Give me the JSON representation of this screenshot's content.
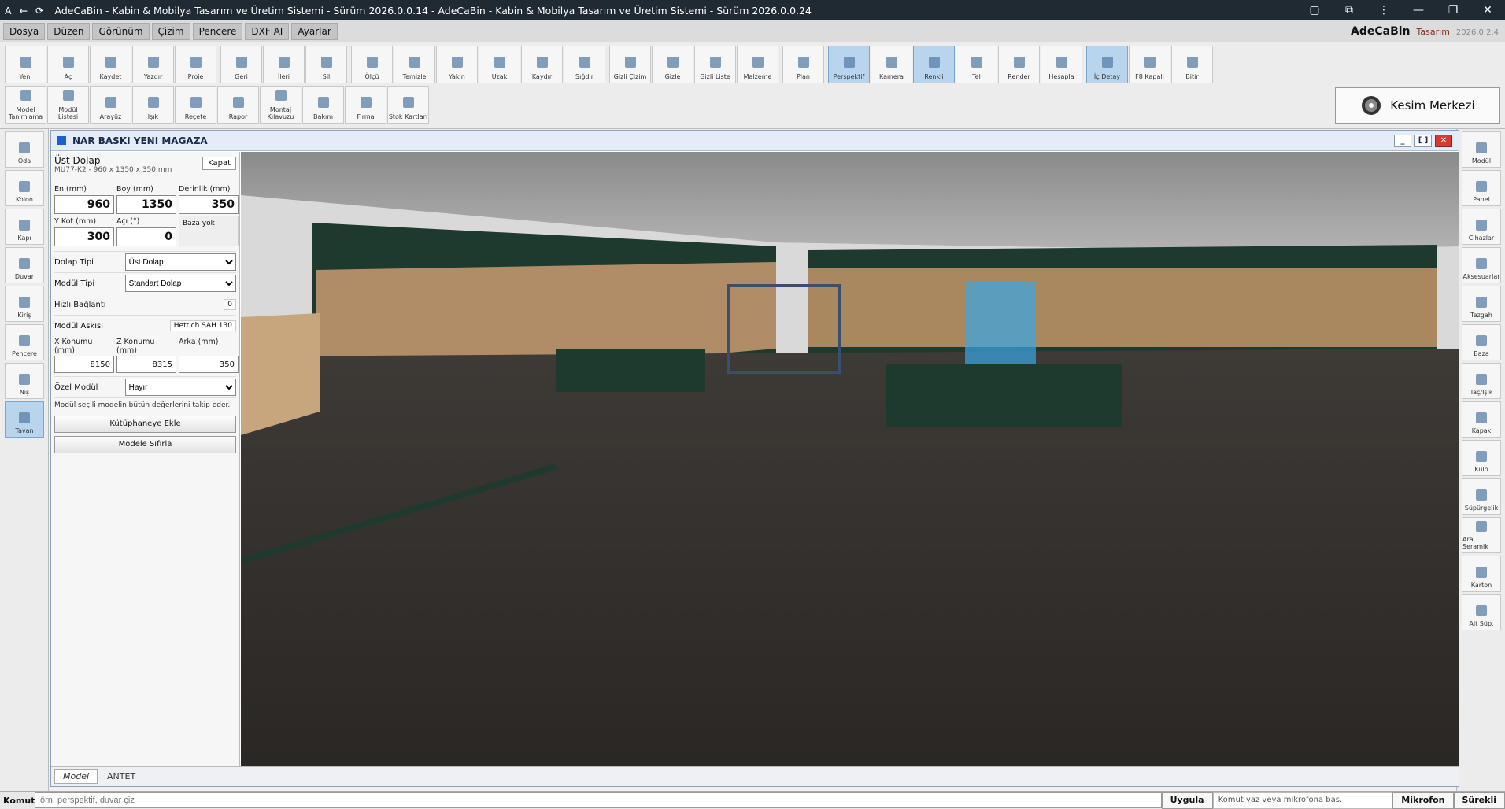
{
  "window": {
    "title": "AdeCaBin - Kabin & Mobilya Tasarım ve Üretim Sistemi - Sürüm 2026.0.0.14 - AdeCaBin - Kabin & Mobilya Tasarım ve Üretim Sistemi - Sürüm 2026.0.0.24",
    "controls": [
      "—",
      "❐",
      "✕"
    ]
  },
  "menu": [
    "Dosya",
    "Düzen",
    "Görünüm",
    "Çizim",
    "Pencere",
    "DXF AI",
    "Ayarlar"
  ],
  "brand": {
    "name": "AdeCaBin",
    "sub": "Tasarım",
    "version": "2026.0.2.4"
  },
  "toolbar_row1": [
    {
      "label": "Yeni",
      "icon": "document-icon"
    },
    {
      "label": "Aç",
      "icon": "folder-open-icon"
    },
    {
      "label": "Kaydet",
      "icon": "save-icon"
    },
    {
      "label": "Yazdır",
      "icon": "print-icon"
    },
    {
      "label": "Proje",
      "icon": "project-icon"
    },
    {
      "label": "Geri",
      "icon": "undo-icon"
    },
    {
      "label": "İleri",
      "icon": "redo-icon"
    },
    {
      "label": "Sil",
      "icon": "trash-icon"
    },
    {
      "label": "Ölçü",
      "icon": "ruler-icon"
    },
    {
      "label": "Temizle",
      "icon": "brush-icon"
    },
    {
      "label": "Yakın",
      "icon": "zoom-in-icon"
    },
    {
      "label": "Uzak",
      "icon": "zoom-out-icon"
    },
    {
      "label": "Kaydır",
      "icon": "hand-icon"
    },
    {
      "label": "Sığdır",
      "icon": "fit-icon"
    },
    {
      "label": "Gizli Çizim",
      "icon": "hidden-draw-icon"
    },
    {
      "label": "Gizle",
      "icon": "eye-off-icon"
    },
    {
      "label": "Gizli Liste",
      "icon": "hidden-list-icon"
    },
    {
      "label": "Malzeme",
      "icon": "material-icon"
    },
    {
      "label": "Plan",
      "icon": "plan-icon"
    },
    {
      "label": "Perspektif",
      "icon": "perspective-icon",
      "active": true
    },
    {
      "label": "Kamera",
      "icon": "camera-icon"
    },
    {
      "label": "Renkli",
      "icon": "cube-colored-icon",
      "active": true
    },
    {
      "label": "Tel",
      "icon": "wireframe-icon"
    },
    {
      "label": "Render",
      "icon": "render-icon"
    },
    {
      "label": "Hesapla",
      "icon": "calculator-icon"
    },
    {
      "label": "İç Detay",
      "icon": "inner-detail-icon",
      "active": true
    },
    {
      "label": "F8 Kapalı",
      "icon": "axis-icon"
    },
    {
      "label": "Bitir",
      "icon": "check-icon"
    }
  ],
  "toolbar_row2": [
    {
      "label": "Model Tanımlama",
      "icon": "model-define-icon"
    },
    {
      "label": "Modül Listesi",
      "icon": "module-list-icon"
    },
    {
      "label": "Arayüz",
      "icon": "interface-icon"
    },
    {
      "label": "Işık",
      "icon": "light-icon"
    },
    {
      "label": "Reçete",
      "icon": "recipe-icon"
    },
    {
      "label": "Rapor",
      "icon": "report-icon"
    },
    {
      "label": "Montaj Kılavuzu",
      "icon": "assembly-guide-icon"
    },
    {
      "label": "Bakım",
      "icon": "tools-icon"
    },
    {
      "label": "Firma",
      "icon": "company-icon"
    },
    {
      "label": "Stok Kartları",
      "icon": "stock-cards-icon"
    }
  ],
  "cut_center": {
    "label": "Kesim Merkezi",
    "icon": "saw-blade-icon"
  },
  "left_tools": [
    {
      "label": "Oda",
      "icon": "room-icon"
    },
    {
      "label": "Kolon",
      "icon": "column-icon"
    },
    {
      "label": "Kapı",
      "icon": "door-icon"
    },
    {
      "label": "Duvar",
      "icon": "wall-icon"
    },
    {
      "label": "Kiriş",
      "icon": "beam-icon"
    },
    {
      "label": "Pencere",
      "icon": "window-icon"
    },
    {
      "label": "Niş",
      "icon": "niche-icon"
    },
    {
      "label": "Tavan",
      "icon": "ceiling-icon",
      "active": true
    }
  ],
  "right_tools": [
    {
      "label": "Modül",
      "icon": "module-icon"
    },
    {
      "label": "Panel",
      "icon": "panel-icon"
    },
    {
      "label": "Cihazlar",
      "icon": "appliance-icon"
    },
    {
      "label": "Aksesuarlar",
      "icon": "accessory-icon"
    },
    {
      "label": "Tezgah",
      "icon": "countertop-icon"
    },
    {
      "label": "Baza",
      "icon": "plinth-icon"
    },
    {
      "label": "Taç/Işık",
      "icon": "crown-light-icon"
    },
    {
      "label": "Kapak",
      "icon": "cover-icon"
    },
    {
      "label": "Kulp",
      "icon": "handle-icon"
    },
    {
      "label": "Süpürgelik",
      "icon": "skirting-icon"
    },
    {
      "label": "Ara Seramik",
      "icon": "ceramic-icon"
    },
    {
      "label": "Karton",
      "icon": "carton-icon"
    },
    {
      "label": "Alt Süp.",
      "icon": "bottom-skirting-icon"
    }
  ],
  "doc": {
    "title": "NAR BASKI YENI MAGAZA",
    "tabs": [
      "Model",
      "ANTET"
    ],
    "active_tab": "Model"
  },
  "props": {
    "name": "Üst Dolap",
    "code": "MU77-K2 - 960 x 1350 x 350 mm",
    "close": "Kapat",
    "labels": {
      "en": "En (mm)",
      "boy": "Boy (mm)",
      "derinlik": "Derinlik (mm)",
      "ykot": "Y Kot (mm)",
      "aci": "Açı (°)"
    },
    "values": {
      "en": "960",
      "boy": "1350",
      "derinlik": "350",
      "ykot": "300",
      "aci": "0"
    },
    "basa": "Baza yok",
    "dolap_tipi_label": "Dolap Tipi",
    "dolap_tipi": "Üst Dolap",
    "modul_tipi_label": "Modül Tipi",
    "modul_tipi": "Standart Dolap",
    "hizli_label": "Hızlı Bağlantı",
    "hizli": "0",
    "aski_label": "Modül Askısı",
    "aski": "Hettich SAH 130",
    "pos_labels": {
      "x": "X Konumu (mm)",
      "z": "Z Konumu (mm)",
      "arka": "Arka (mm)"
    },
    "pos_values": {
      "x": "8150",
      "z": "8315",
      "arka": "350"
    },
    "ozel_label": "Özel Modül",
    "ozel": "Hayır",
    "note": "Modül seçili modelin bütün değerlerini takip eder.",
    "btn_library": "Kütüphaneye Ekle",
    "btn_reset": "Modele Sıfırla"
  },
  "status": {
    "cmd_label": "Komut:",
    "cmd_placeholder": "örn. perspektif, duvar çiz",
    "apply": "Uygula",
    "message": "Komut yaz veya mikrofona bas.",
    "mic": "Mikrofon",
    "mode": "Sürekli"
  }
}
